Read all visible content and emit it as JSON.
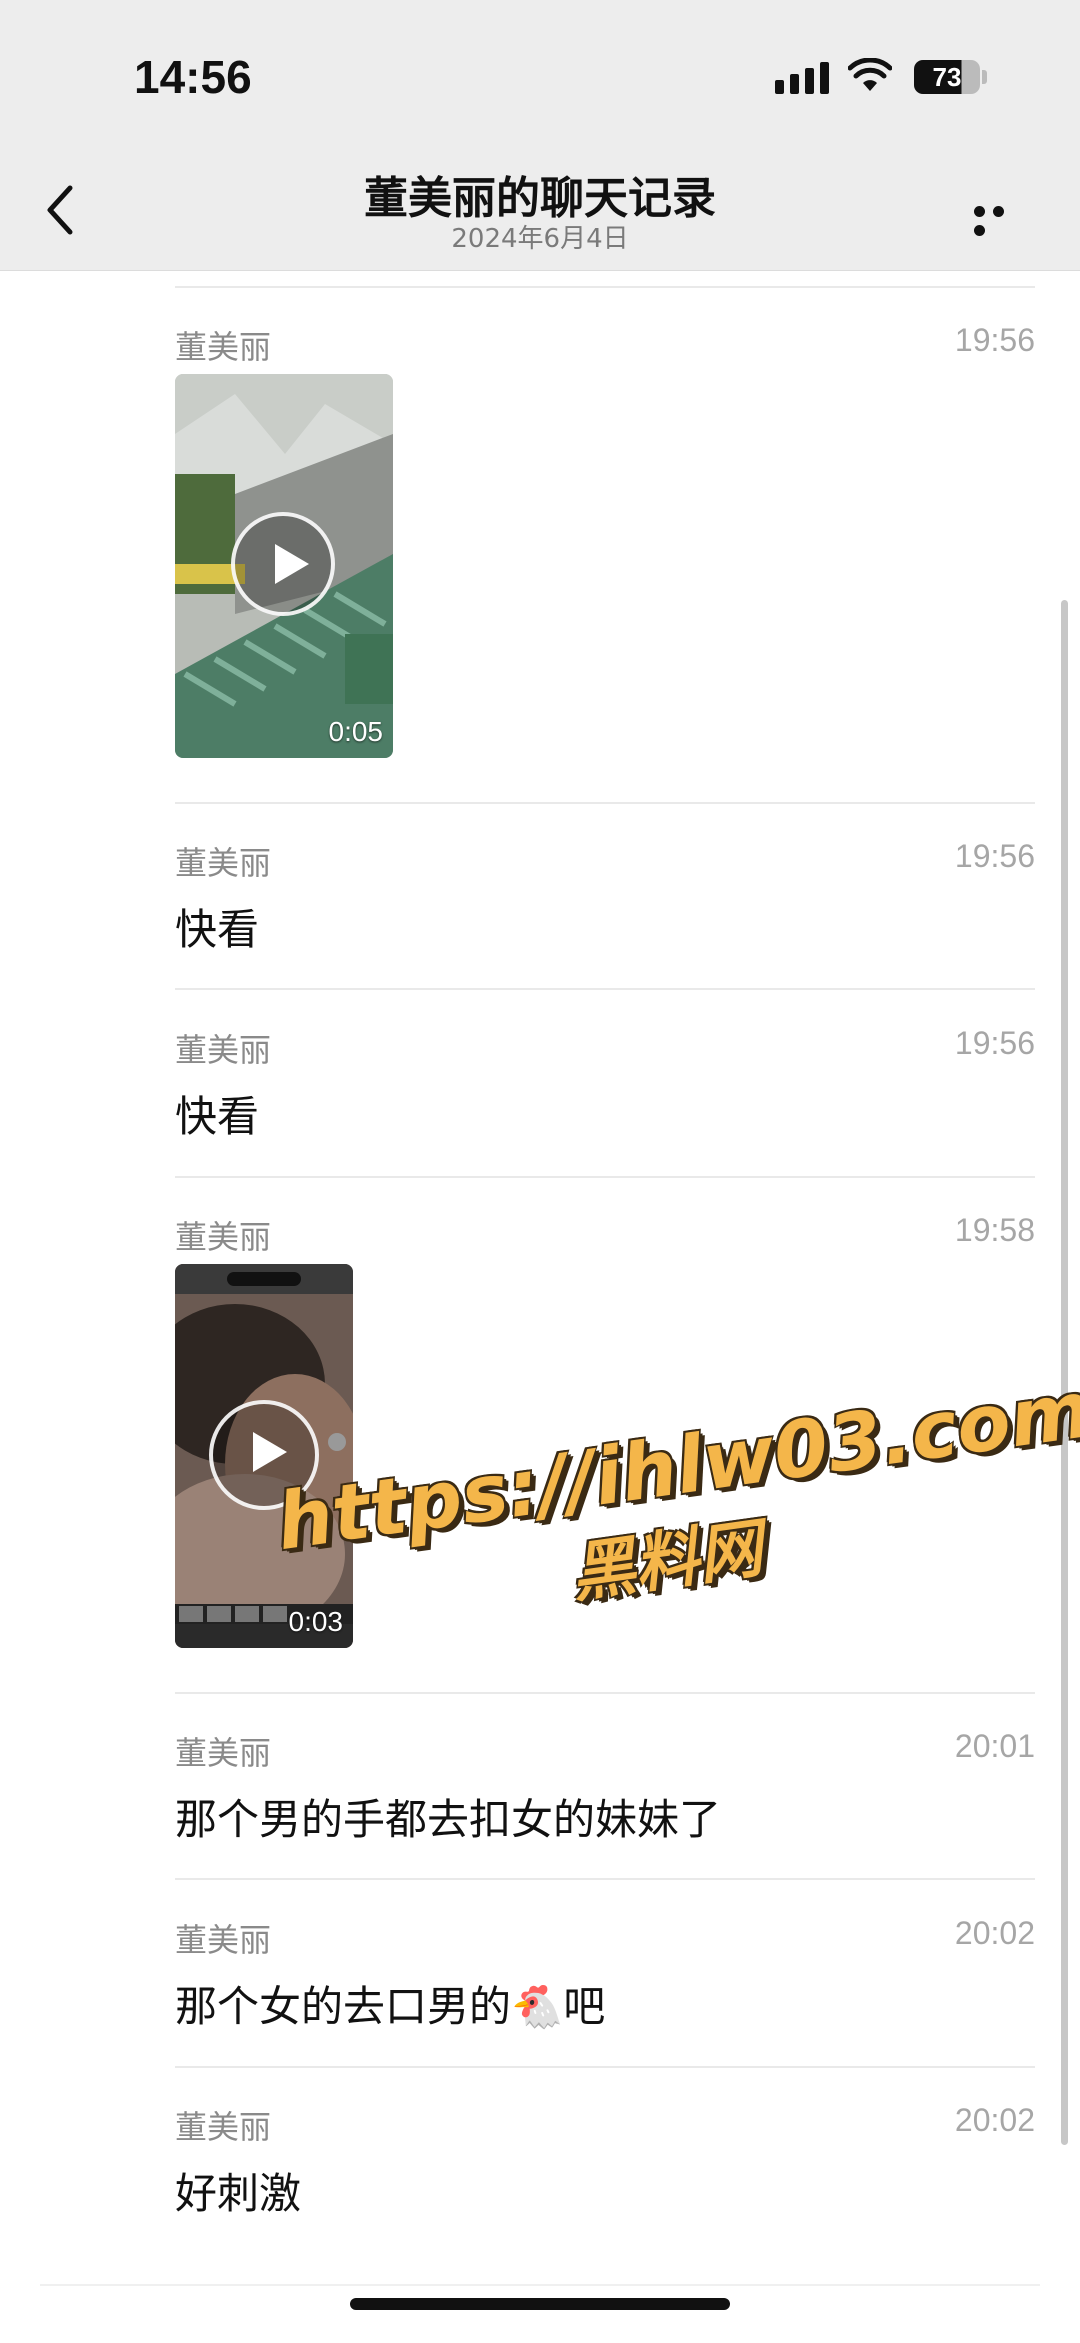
{
  "status_bar": {
    "time": "14:56",
    "battery": "73",
    "icons": [
      "signal-icon",
      "wifi-icon",
      "battery-icon"
    ]
  },
  "header": {
    "title": "董美丽的聊天记录",
    "subtitle": "2024年6月4日",
    "icons": [
      "back-chevron-icon",
      "more-dots-icon"
    ]
  },
  "messages": [
    {
      "sender": "董美丽",
      "time": "19:56",
      "type": "video",
      "duration": "0:05"
    },
    {
      "sender": "董美丽",
      "time": "19:56",
      "type": "text",
      "text": "快看"
    },
    {
      "sender": "董美丽",
      "time": "19:56",
      "type": "text",
      "text": "快看"
    },
    {
      "sender": "董美丽",
      "time": "19:58",
      "type": "video",
      "duration": "0:03"
    },
    {
      "sender": "董美丽",
      "time": "20:01",
      "type": "text",
      "text": "那个男的手都去扣女的妹妹了"
    },
    {
      "sender": "董美丽",
      "time": "20:02",
      "type": "text",
      "text": "那个女的去口男的🐔吧"
    },
    {
      "sender": "董美丽",
      "time": "20:02",
      "type": "text",
      "text": "好刺激"
    }
  ],
  "watermark": {
    "line1": "https://ihlw03.com",
    "line2": "黑料网"
  },
  "colors": {
    "header_bg": "#ededed",
    "secondary_text": "#8a8a8a",
    "watermark": "#f4b64a"
  }
}
